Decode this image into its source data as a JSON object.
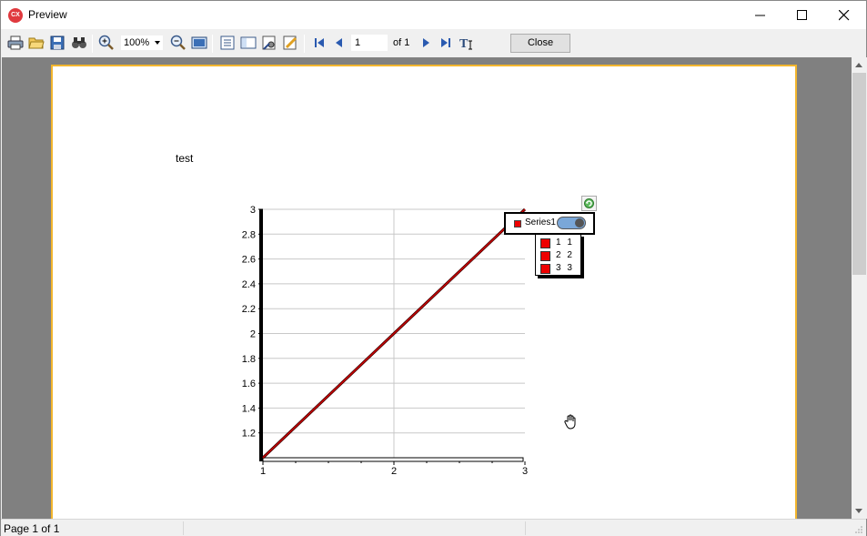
{
  "window": {
    "title": "Preview",
    "app_icon_text": "CX"
  },
  "toolbar": {
    "zoom": "100%",
    "page_current": "1",
    "page_of": "of 1",
    "close_label": "Close"
  },
  "report": {
    "title": "test"
  },
  "chart_data": {
    "type": "line",
    "x": [
      1,
      2,
      3
    ],
    "series": [
      {
        "name": "Series1",
        "values": [
          1,
          2,
          3
        ]
      }
    ],
    "xlim": [
      1,
      3
    ],
    "ylim": [
      1,
      3
    ],
    "x_ticks": [
      "1",
      "2",
      "3"
    ],
    "y_ticks": [
      "1.2",
      "1.4",
      "1.6",
      "1.8",
      "2",
      "2.2",
      "2.4",
      "2.6",
      "2.8",
      "3"
    ],
    "grid": true,
    "legend": "top-right",
    "series_color": "#cc0000"
  },
  "legend": {
    "series_label": "Series1",
    "points": [
      "1 1",
      "2 2",
      "3 3"
    ]
  },
  "status": {
    "text": "Page 1 of 1"
  }
}
